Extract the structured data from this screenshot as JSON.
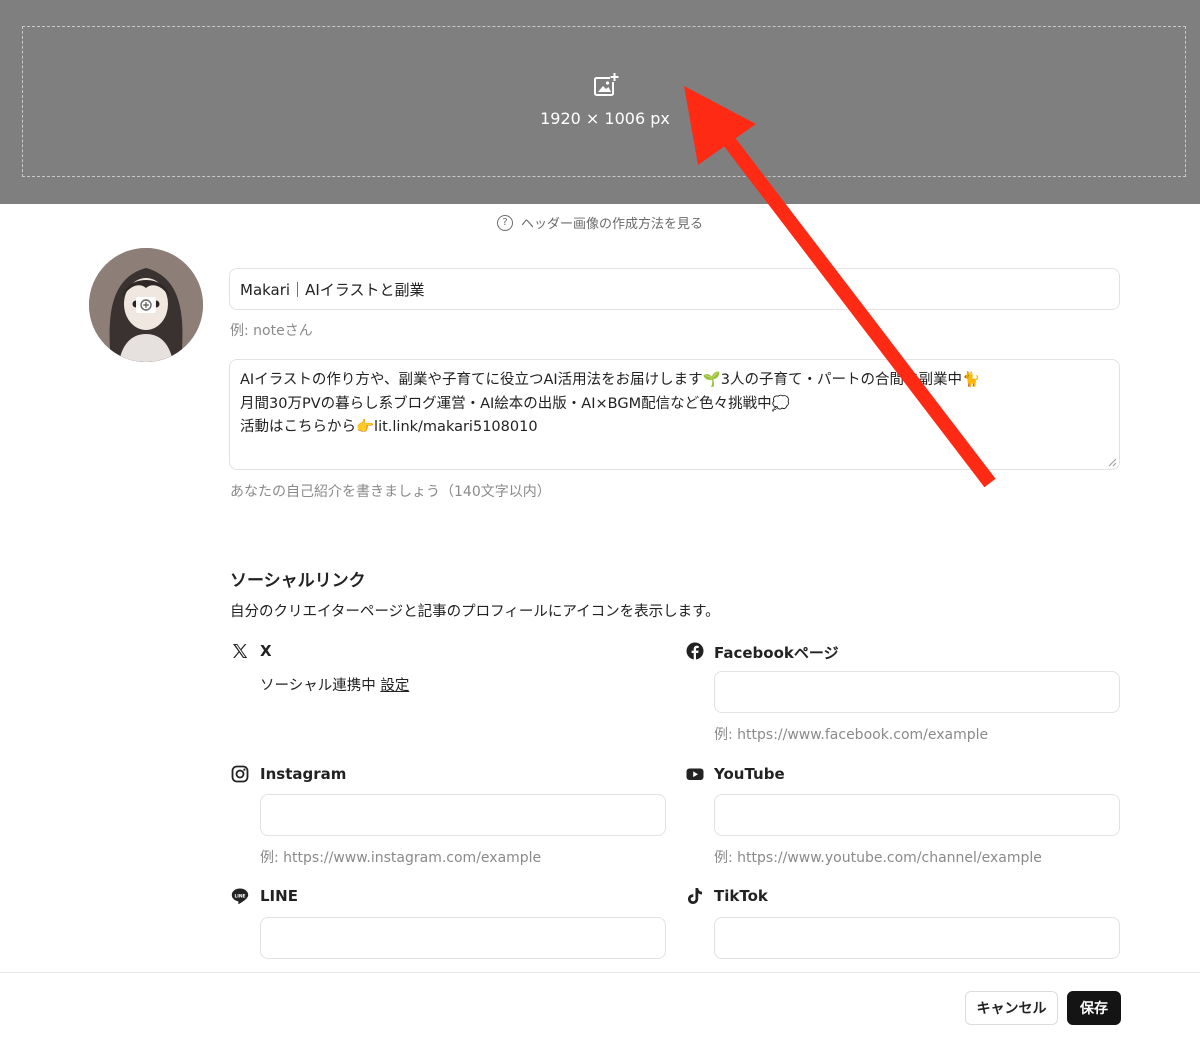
{
  "header_image": {
    "size_label": "1920 × 1006 px",
    "help_label": "ヘッダー画像の作成方法を見る",
    "help_symbol": "?"
  },
  "profile": {
    "name_value": "Makari｜AIイラストと副業",
    "name_hint": "例: noteさん",
    "bio_lines": [
      "AIイラストの作り方や、副業や子育てに役立つAI活用法をお届けします🌱3人の子育て・パートの合間に副業中🐈",
      "月間30万PVの暮らし系ブログ運営・AI絵本の出版・AI×BGM配信など色々挑戦中💭",
      "活動はこちらから👉lit.link/makari5108010"
    ],
    "bio_hint": "あなたの自己紹介を書きましょう（140文字以内）"
  },
  "social": {
    "title": "ソーシャルリンク",
    "description": "自分のクリエイターページと記事のプロフィールにアイコンを表示します。",
    "x": {
      "label": "X",
      "status": "ソーシャル連携中",
      "link": "設定"
    },
    "facebook": {
      "label": "Facebookページ",
      "placeholder": "",
      "hint": "例: https://www.facebook.com/example"
    },
    "instagram": {
      "label": "Instagram",
      "placeholder": "",
      "hint": "例: https://www.instagram.com/example"
    },
    "youtube": {
      "label": "YouTube",
      "placeholder": "",
      "hint": "例: https://www.youtube.com/channel/example"
    },
    "line": {
      "label": "LINE",
      "placeholder": ""
    },
    "tiktok": {
      "label": "TikTok",
      "placeholder": ""
    }
  },
  "footer": {
    "cancel_label": "キャンセル",
    "save_label": "保存"
  },
  "annotation": {
    "arrow_color": "#ff2a14"
  },
  "colors": {
    "header_bg": "#7f7f7f",
    "save_bg": "#141414"
  }
}
